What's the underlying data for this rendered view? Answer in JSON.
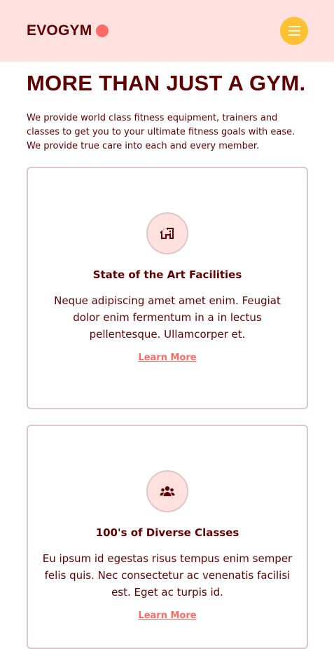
{
  "navbar": {
    "logo_text": "EVOGYM",
    "menu_icon": "hamburger-menu-icon"
  },
  "colors": {
    "primary_100": "#ffe1e0",
    "primary_300": "#ff6b66",
    "secondary_500": "#ffc132",
    "gray_500": "#5e0000",
    "card_border": "#dcc8c8"
  },
  "benefits": {
    "title": "MORE THAN JUST A GYM.",
    "intro": "We provide world class fitness equipment, trainers and classes to get you to your ultimate fitness goals with ease. We provide true care into each and every member.",
    "cards": [
      {
        "icon": "home-modern-icon",
        "title": "State of the Art Facilities",
        "description": "Neque adipiscing amet amet enim. Feugiat dolor enim fermentum in a in lectus pellentesque. Ullamcorper et.",
        "link": "Learn More"
      },
      {
        "icon": "user-group-icon",
        "title": "100's of Diverse Classes",
        "description": "Eu ipsum id egestas risus tempus enim semper felis quis. Nec consectetur ac venenatis facilisi est. Eget ac turpis id.",
        "link": "Learn More"
      }
    ]
  }
}
